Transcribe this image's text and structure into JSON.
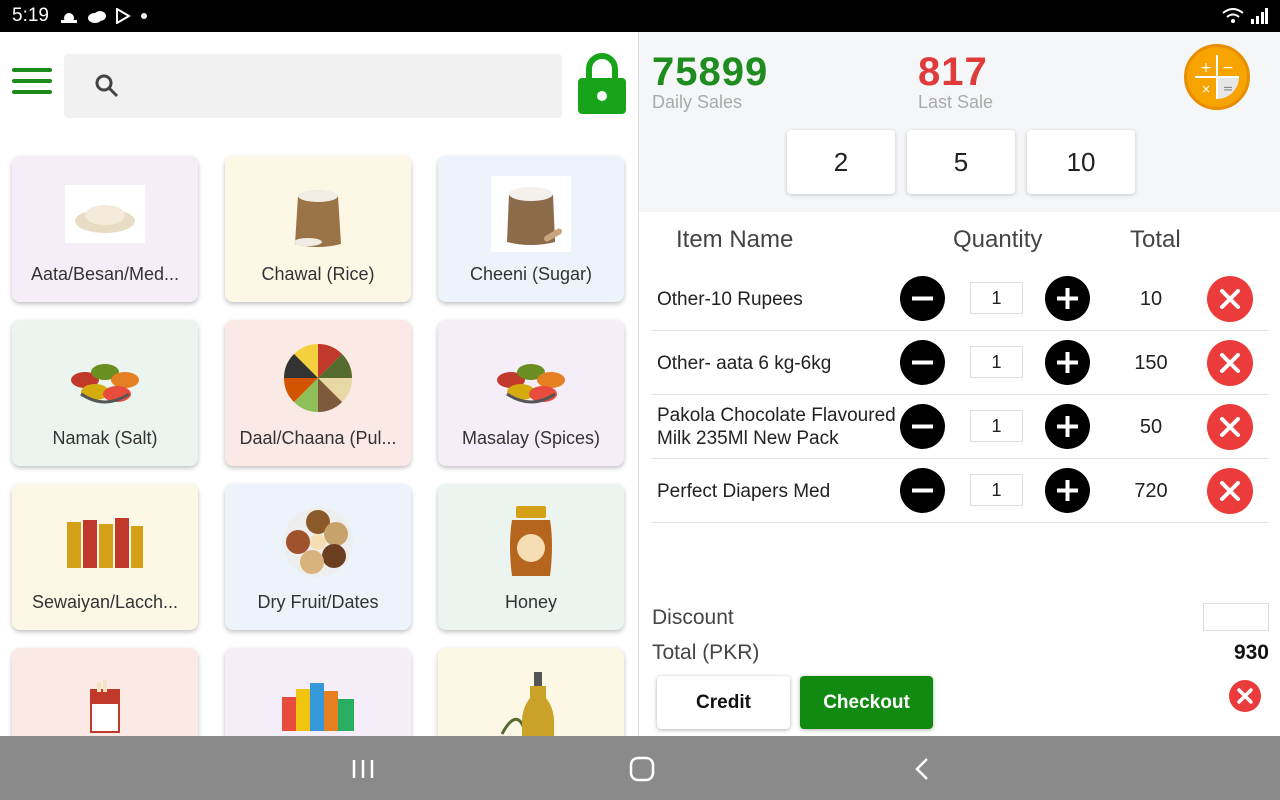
{
  "status_bar": {
    "time": "5:19",
    "icons": [
      "weather-icon",
      "cloud-icon",
      "play-store-icon",
      "dot-icon"
    ],
    "right_icons": [
      "wifi-icon",
      "signal-icon"
    ]
  },
  "search": {
    "placeholder": ""
  },
  "categories": [
    {
      "label": "Aata/Besan/Med...",
      "bg": "#f5eef8",
      "icon": "flour-icon"
    },
    {
      "label": "Chawal (Rice)",
      "bg": "#fdf8e6",
      "icon": "rice-sack-icon"
    },
    {
      "label": "Cheeni (Sugar)",
      "bg": "#ecf3fb",
      "icon": "sugar-sack-icon"
    },
    {
      "label": "Namak (Salt)",
      "bg": "#ebf4ef",
      "icon": "spice-bowls-icon"
    },
    {
      "label": "Daal/Chaana (Pul...",
      "bg": "#fbe9e6",
      "icon": "pulses-wheel-icon"
    },
    {
      "label": "Masalay (Spices)",
      "bg": "#f5eef8",
      "icon": "spice-bowls-icon"
    },
    {
      "label": "Sewaiyan/Lacch...",
      "bg": "#fdf8e6",
      "icon": "vermicelli-packs-icon"
    },
    {
      "label": "Dry Fruit/Dates",
      "bg": "#ecf3fb",
      "icon": "dry-fruit-platter-icon"
    },
    {
      "label": "Honey",
      "bg": "#ebf4ef",
      "icon": "honey-jar-icon"
    },
    {
      "label": "",
      "bg": "#fbe9e6",
      "icon": "cigarette-pack-icon"
    },
    {
      "label": "",
      "bg": "#f5eef8",
      "icon": "snack-packs-icon"
    },
    {
      "label": "",
      "bg": "#fdf8e6",
      "icon": "oil-bottle-icon"
    }
  ],
  "stats": {
    "daily_sales_value": "75899",
    "daily_sales_label": "Daily Sales",
    "last_sale_value": "817",
    "last_sale_label": "Last Sale"
  },
  "quick_amounts": [
    "2",
    "5",
    "10"
  ],
  "cart": {
    "headers": {
      "name": "Item Name",
      "quantity": "Quantity",
      "total": "Total"
    },
    "items": [
      {
        "name": "Other-10 Rupees",
        "qty": "1",
        "total": "10"
      },
      {
        "name": "Other- aata 6 kg-6kg",
        "qty": "1",
        "total": "150"
      },
      {
        "name": "Pakola Chocolate Flavoured Milk 235Ml New Pack",
        "qty": "1",
        "total": "50"
      },
      {
        "name": "Perfect Diapers Med",
        "qty": "1",
        "total": "720"
      }
    ]
  },
  "summary": {
    "discount_label": "Discount",
    "discount_value": "",
    "total_label": "Total (PKR)",
    "total_value": "930"
  },
  "actions": {
    "credit": "Credit",
    "checkout": "Checkout"
  },
  "colors": {
    "green": "#1e8c1e",
    "red": "#e03a3a",
    "checkout": "#118a11",
    "calc": "#f7a300"
  }
}
